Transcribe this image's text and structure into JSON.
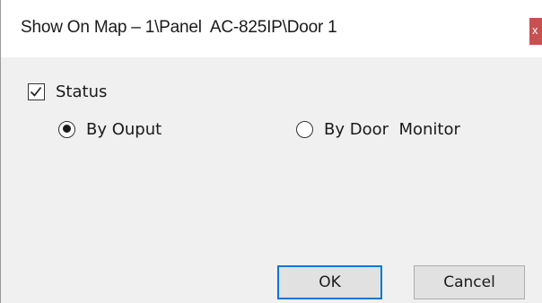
{
  "window": {
    "title": "Show On Map – 1\\Panel  AC-825IP\\Door 1",
    "close_label": "x"
  },
  "status": {
    "label": "Status",
    "checked": true
  },
  "options": {
    "by_output": {
      "label": "By Ouput",
      "selected": true
    },
    "by_door_monitor": {
      "label": "By Door  Monitor",
      "selected": false
    }
  },
  "buttons": {
    "ok": "OK",
    "cancel": "Cancel"
  },
  "icons": {
    "check": "checkmark-icon",
    "close": "close-icon"
  },
  "colors": {
    "close_button": "#c75050",
    "default_button_border": "#0078d7"
  }
}
